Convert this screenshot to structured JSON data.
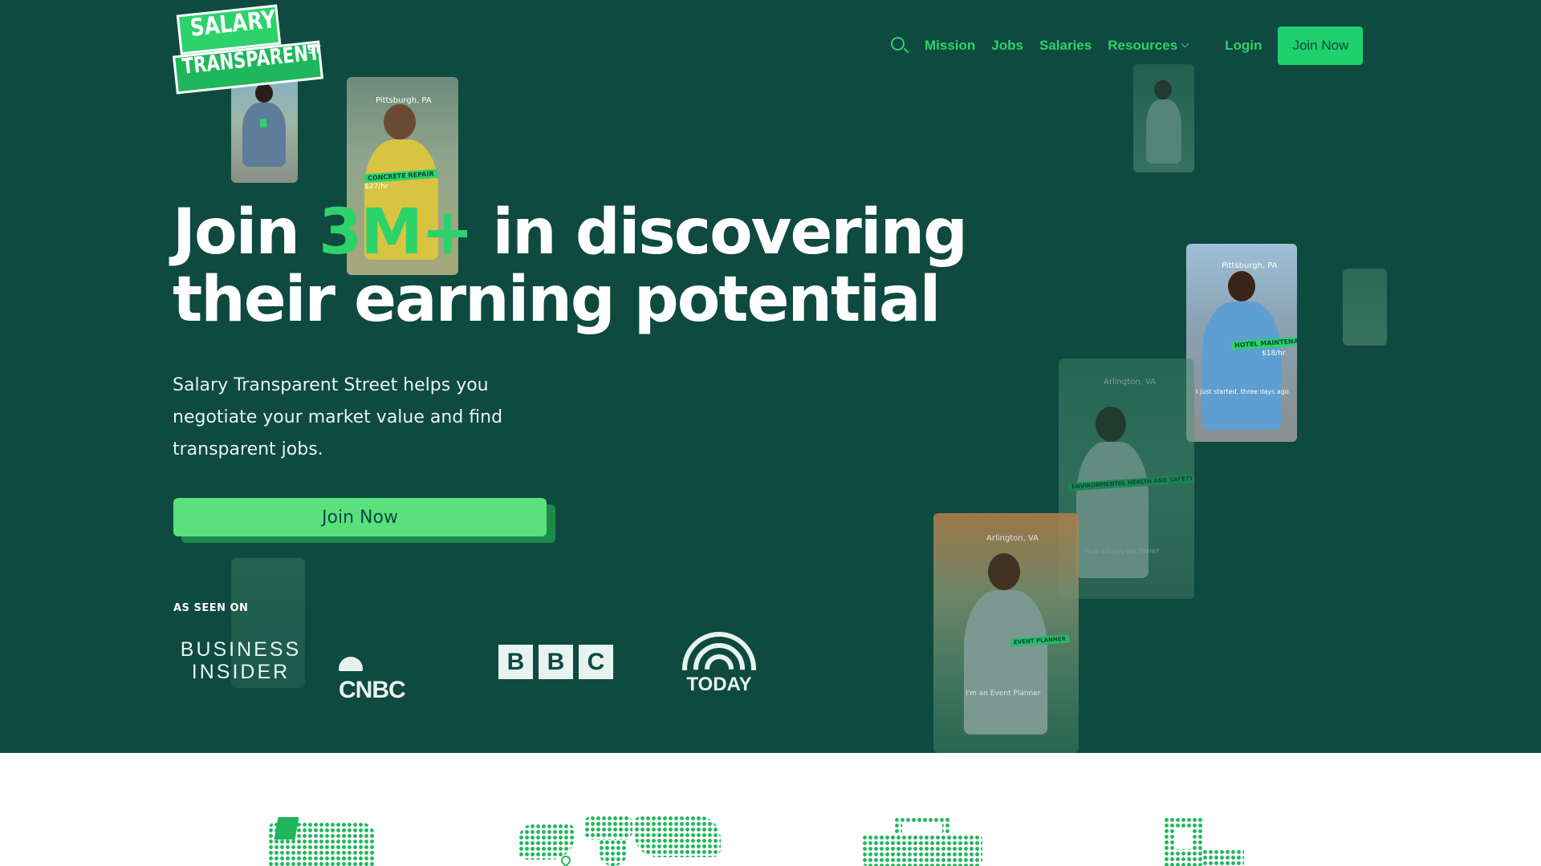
{
  "brand": {
    "line1": "SALARY",
    "line2": "TRANSPARENT",
    "suffix": "ST"
  },
  "nav": {
    "items": [
      "Mission",
      "Jobs",
      "Salaries",
      "Resources"
    ],
    "login": "Login",
    "join": "Join Now",
    "icons": [
      "search-icon",
      "chevron-down-icon"
    ]
  },
  "hero": {
    "headline_pre": "Join ",
    "headline_accent": "3M+",
    "headline_post": " in discovering",
    "headline_line2": "their earning potential",
    "subtext": "Salary Transparent Street helps you negotiate your market value and find transparent jobs.",
    "cta": "Join Now"
  },
  "press": {
    "label": "AS SEEN ON",
    "outlets": {
      "business_insider_1": "BUSINESS",
      "business_insider_2": "INSIDER",
      "cnbc": "CNBC",
      "bbc": [
        "B",
        "B",
        "C"
      ],
      "today": "TODAY"
    }
  },
  "cards": {
    "pittsburgh_top": {
      "location": "Pittsburgh, PA",
      "job": "CONCRETE REPAIR",
      "pay": "$27/hr"
    },
    "pittsburgh_right": {
      "location": "Pittsburgh, PA",
      "job": "HOTEL MAINTENANCE",
      "pay": "$18/hr",
      "caption": "I just started, three days ago."
    },
    "arlington_back": {
      "location": "Arlington, VA",
      "job": "ENVIRONMENTAL HEALTH AND SAFETY",
      "caption": "How did you get there?"
    },
    "arlington_front": {
      "location": "Arlington, VA",
      "job": "EVENT PLANNER",
      "caption": "I'm an Event Planner"
    }
  },
  "colors": {
    "hero_bg": "#0e4a3f",
    "accent": "#2dd26b",
    "cta": "#5be07e"
  }
}
